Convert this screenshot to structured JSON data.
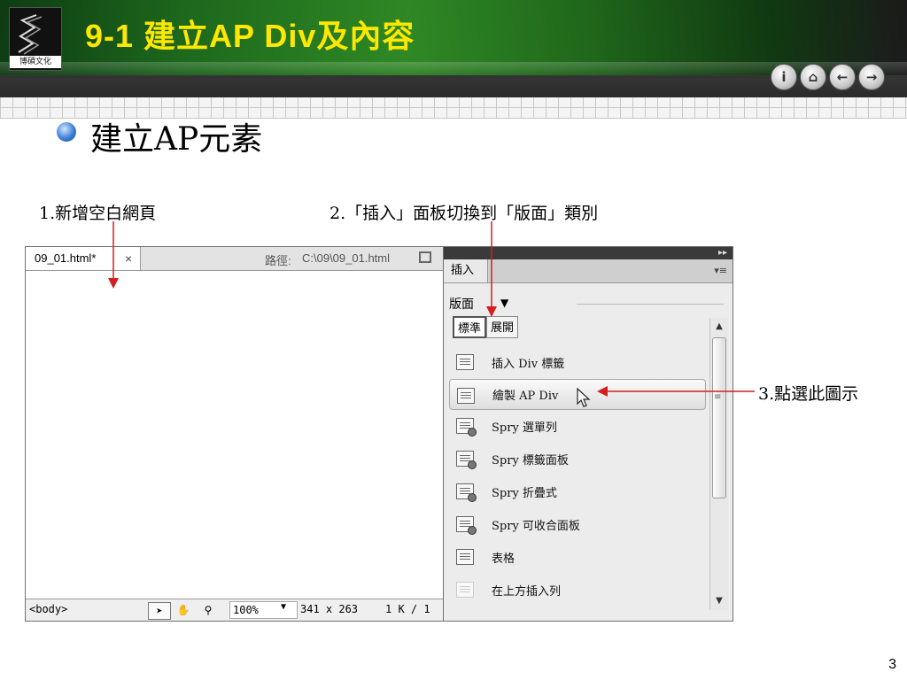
{
  "header": {
    "title": "9-1  建立AP Div及內容",
    "logo_text": "博碩文化",
    "nav_buttons": [
      {
        "icon": "info-icon",
        "glyph": "i"
      },
      {
        "icon": "home-icon",
        "glyph": "⌂"
      },
      {
        "icon": "back-arrow-icon",
        "glyph": "←"
      },
      {
        "icon": "forward-arrow-icon",
        "glyph": "→"
      }
    ]
  },
  "heading": "建立AP元素",
  "steps": {
    "step1": "1.新增空白網頁",
    "step2": "2.「插入」面板切換到「版面」類別",
    "step3": "3.點選此圖示"
  },
  "document": {
    "tab_label": "09_01.html*",
    "close_glyph": "×",
    "path_label": "路徑:",
    "path_value": "C:\\09\\09_01.html",
    "status": {
      "tag": "<body>",
      "zoom": "100%",
      "size": "341 x 263",
      "filesize": "1 K / 1"
    }
  },
  "panel": {
    "tab_label": "插入",
    "category": "版面",
    "segments": [
      "標準",
      "展開"
    ],
    "items": [
      {
        "label": "插入 Div 標籤",
        "icon": "insert-div-icon"
      },
      {
        "label": "繪製 AP Div",
        "icon": "draw-ap-div-icon"
      },
      {
        "label": "Spry 選單列",
        "icon": "spry-menu-bar-icon"
      },
      {
        "label": "Spry 標籤面板",
        "icon": "spry-tabbed-panels-icon"
      },
      {
        "label": "Spry 折疊式",
        "icon": "spry-accordion-icon"
      },
      {
        "label": "Spry 可收合面板",
        "icon": "spry-collapsible-panel-icon"
      },
      {
        "label": "表格",
        "icon": "table-icon"
      },
      {
        "label": "在上方插入列",
        "icon": "insert-row-above-icon"
      }
    ]
  },
  "page_number": "3",
  "colors": {
    "title": "#ffe800",
    "arrow": "#d21f1f",
    "banner_green": "#2f8d24"
  }
}
